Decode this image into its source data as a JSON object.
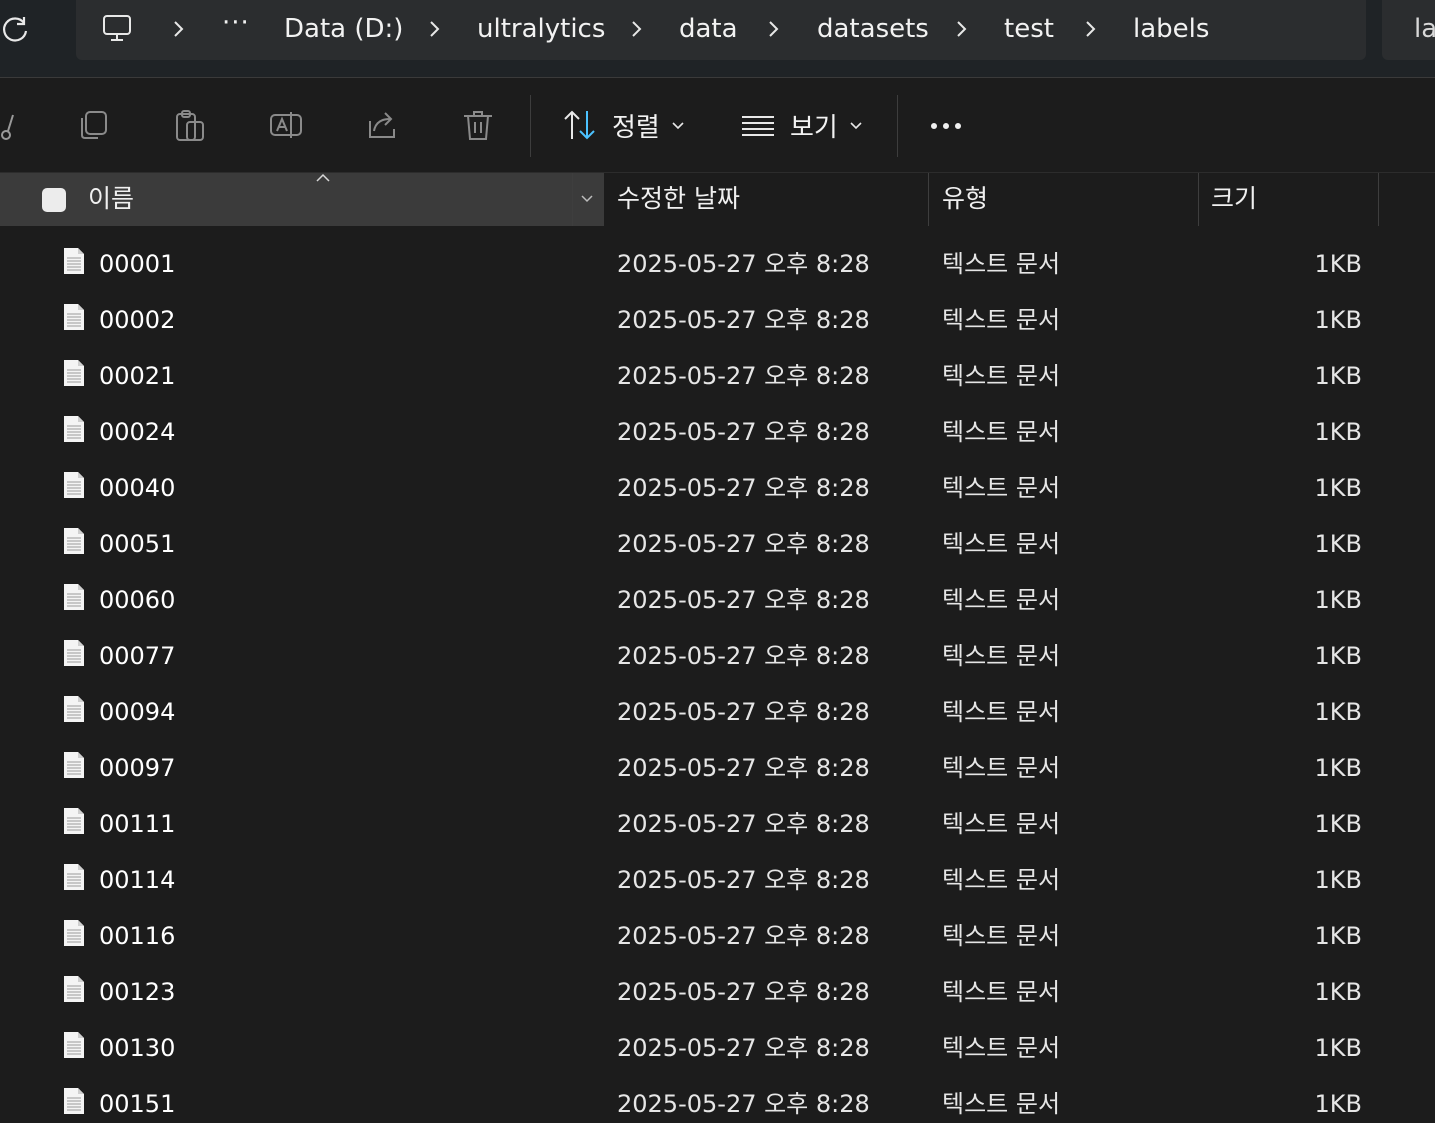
{
  "address_bar": {
    "overflow": "···",
    "breadcrumbs": [
      "Data (D:)",
      "ultralytics",
      "data",
      "datasets",
      "test",
      "labels"
    ],
    "search_text": "la"
  },
  "command_bar": {
    "sort_label": "정렬",
    "view_label": "보기"
  },
  "columns": {
    "name": "이름",
    "modified": "수정한 날짜",
    "type": "유형",
    "size": "크기"
  },
  "files": [
    {
      "name": "00001",
      "modified": "2025-05-27 오후 8:28",
      "type": "텍스트 문서",
      "size": "1KB"
    },
    {
      "name": "00002",
      "modified": "2025-05-27 오후 8:28",
      "type": "텍스트 문서",
      "size": "1KB"
    },
    {
      "name": "00021",
      "modified": "2025-05-27 오후 8:28",
      "type": "텍스트 문서",
      "size": "1KB"
    },
    {
      "name": "00024",
      "modified": "2025-05-27 오후 8:28",
      "type": "텍스트 문서",
      "size": "1KB"
    },
    {
      "name": "00040",
      "modified": "2025-05-27 오후 8:28",
      "type": "텍스트 문서",
      "size": "1KB"
    },
    {
      "name": "00051",
      "modified": "2025-05-27 오후 8:28",
      "type": "텍스트 문서",
      "size": "1KB"
    },
    {
      "name": "00060",
      "modified": "2025-05-27 오후 8:28",
      "type": "텍스트 문서",
      "size": "1KB"
    },
    {
      "name": "00077",
      "modified": "2025-05-27 오후 8:28",
      "type": "텍스트 문서",
      "size": "1KB"
    },
    {
      "name": "00094",
      "modified": "2025-05-27 오후 8:28",
      "type": "텍스트 문서",
      "size": "1KB"
    },
    {
      "name": "00097",
      "modified": "2025-05-27 오후 8:28",
      "type": "텍스트 문서",
      "size": "1KB"
    },
    {
      "name": "00111",
      "modified": "2025-05-27 오후 8:28",
      "type": "텍스트 문서",
      "size": "1KB"
    },
    {
      "name": "00114",
      "modified": "2025-05-27 오후 8:28",
      "type": "텍스트 문서",
      "size": "1KB"
    },
    {
      "name": "00116",
      "modified": "2025-05-27 오후 8:28",
      "type": "텍스트 문서",
      "size": "1KB"
    },
    {
      "name": "00123",
      "modified": "2025-05-27 오후 8:28",
      "type": "텍스트 문서",
      "size": "1KB"
    },
    {
      "name": "00130",
      "modified": "2025-05-27 오후 8:28",
      "type": "텍스트 문서",
      "size": "1KB"
    },
    {
      "name": "00151",
      "modified": "2025-05-27 오후 8:28",
      "type": "텍스트 문서",
      "size": "1KB"
    }
  ],
  "icons": {
    "refresh": "refresh-icon",
    "this_pc": "computer-icon",
    "cut": "scissors-icon",
    "copy": "copy-icon",
    "paste": "paste-icon",
    "rename": "rename-icon",
    "share": "share-icon",
    "delete": "trash-icon",
    "sort": "sort-arrows-icon",
    "view": "list-view-icon",
    "more": "more-icon",
    "file": "text-file-icon"
  },
  "colors": {
    "background": "#1c1c1c",
    "address_bar": "#2b2d2f",
    "selected_column_header": "#3b3b3b",
    "text": "#ffffff"
  }
}
